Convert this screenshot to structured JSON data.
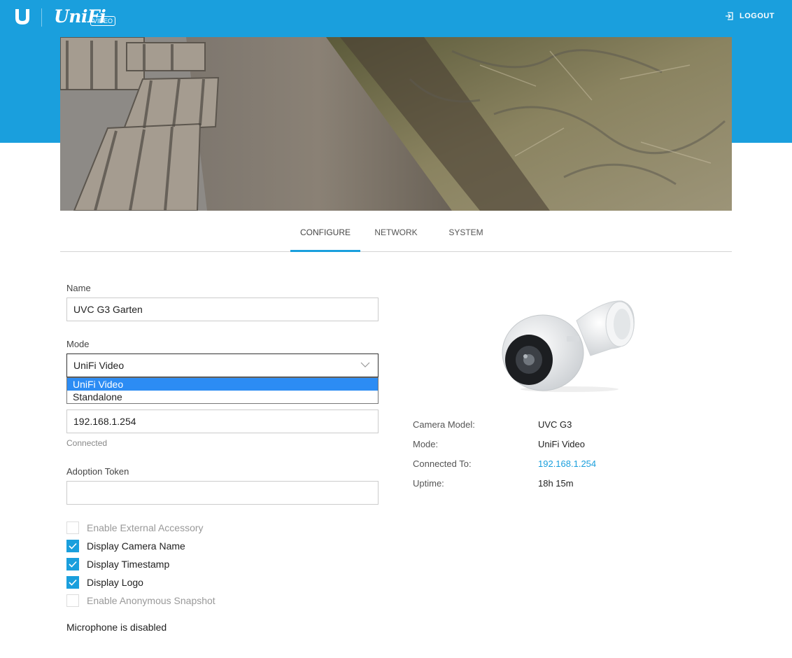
{
  "header": {
    "brand": "UniFi",
    "badge": "VIDEO",
    "logout": "LOGOUT"
  },
  "tabs": [
    {
      "label": "CONFIGURE",
      "active": true
    },
    {
      "label": "NETWORK",
      "active": false
    },
    {
      "label": "SYSTEM",
      "active": false
    }
  ],
  "form": {
    "name_label": "Name",
    "name_value": "UVC G3 Garten",
    "mode_label": "Mode",
    "mode_value": "UniFi Video",
    "mode_options": [
      "UniFi Video",
      "Standalone"
    ],
    "controller_value": "192.168.1.254",
    "controller_status": "Connected",
    "token_label": "Adoption Token",
    "token_value": "",
    "checkboxes": [
      {
        "label": "Enable External Accessory",
        "checked": false,
        "disabled": true
      },
      {
        "label": "Display Camera Name",
        "checked": true,
        "disabled": false
      },
      {
        "label": "Display Timestamp",
        "checked": true,
        "disabled": false
      },
      {
        "label": "Display Logo",
        "checked": true,
        "disabled": false
      },
      {
        "label": "Enable Anonymous Snapshot",
        "checked": false,
        "disabled": true
      }
    ],
    "microphone": "Microphone is disabled"
  },
  "info": [
    {
      "key": "Camera Model:",
      "value": "UVC G3"
    },
    {
      "key": "Mode:",
      "value": "UniFi Video"
    },
    {
      "key": "Connected To:",
      "value": "192.168.1.254"
    },
    {
      "key": "Uptime:",
      "value": "18h 15m"
    }
  ],
  "colors": {
    "brand_blue": "#1a9fdd",
    "select_highlight": "#2c8cf4"
  },
  "icons": [
    "ubiquiti-u-icon",
    "logout-icon",
    "chevron-down-icon",
    "checkmark-icon"
  ]
}
